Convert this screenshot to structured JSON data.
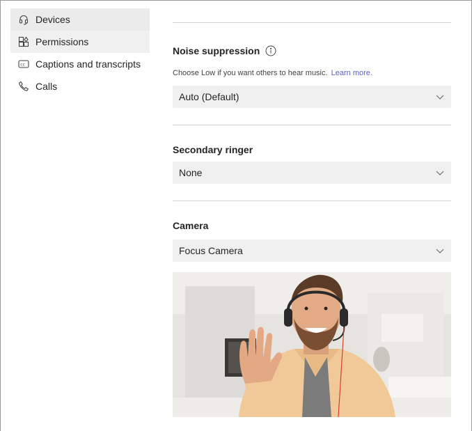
{
  "sidebar": {
    "items": [
      {
        "label": "Devices",
        "icon": "headset-icon"
      },
      {
        "label": "Permissions",
        "icon": "permissions-icon"
      },
      {
        "label": "Captions and transcripts",
        "icon": "closed-captions-icon"
      },
      {
        "label": "Calls",
        "icon": "phone-icon"
      }
    ]
  },
  "noise_suppression": {
    "title": "Noise suppression",
    "helper_text": "Choose Low if you want others to hear music.",
    "learn_more": "Learn more.",
    "selected": "Auto (Default)"
  },
  "secondary_ringer": {
    "title": "Secondary ringer",
    "selected": "None"
  },
  "camera": {
    "title": "Camera",
    "selected": "Focus Camera"
  },
  "colors": {
    "selected_bg": "#ebebeb",
    "dropdown_bg": "#f0f0f0",
    "link": "#5b5fc7",
    "divider": "#d1d1d1"
  }
}
